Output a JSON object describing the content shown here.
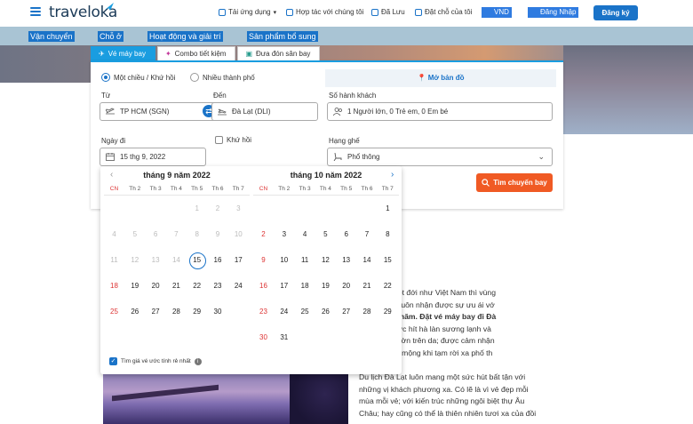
{
  "brand": {
    "logo": "traveloka"
  },
  "nav": {
    "app": "Tải ứng dụng",
    "partner": "Hợp tác với chúng tôi",
    "saved": "Đã Lưu",
    "bookings": "Đặt chỗ của tôi",
    "currency": "VND",
    "login": "Đăng Nhập",
    "register": "Đăng ký"
  },
  "categories": [
    "Vận chuyển",
    "Chỗ ở",
    "Hoạt động và giải trí",
    "Sản phẩm bổ sung"
  ],
  "product_tabs": [
    {
      "label": "Vé máy bay",
      "active": true
    },
    {
      "label": "Combo tiết kiệm",
      "active": false
    },
    {
      "label": "Đưa đón sân bay",
      "active": false
    }
  ],
  "search": {
    "trip_oneway": "Một chiều / Khứ hồi",
    "trip_multi": "Nhiều thành phố",
    "map_button": "Mở bản đồ",
    "from_label": "Từ",
    "from_value": "TP HCM (SGN)",
    "to_label": "Đến",
    "to_value": "Đà Lạt (DLI)",
    "pax_label": "Số hành khách",
    "pax_value": "1 Người lớn, 0 Trẻ em, 0 Em bé",
    "depart_label": "Ngày đi",
    "depart_value": "15 thg 9, 2022",
    "return_label": "Khứ hồi",
    "class_label": "Hạng ghế",
    "class_value": "Phổ thông",
    "search_button": "Tìm chuyến bay"
  },
  "calendar": {
    "weekdays": [
      "CN",
      "Th 2",
      "Th 3",
      "Th 4",
      "Th 5",
      "Th 6",
      "Th 7"
    ],
    "months": [
      {
        "title": "tháng 9 năm 2022",
        "weeks": [
          [
            "",
            "",
            "",
            "",
            "1",
            "2",
            "3"
          ],
          [
            "4",
            "5",
            "6",
            "7",
            "8",
            "9",
            "10"
          ],
          [
            "11",
            "12",
            "13",
            "14",
            "15",
            "16",
            "17"
          ],
          [
            "18",
            "19",
            "20",
            "21",
            "22",
            "23",
            "24"
          ],
          [
            "25",
            "26",
            "27",
            "28",
            "29",
            "30",
            ""
          ]
        ],
        "disabled_through": 14,
        "selected": "15"
      },
      {
        "title": "tháng 10 năm 2022",
        "weeks": [
          [
            "",
            "",
            "",
            "",
            "",
            "",
            "1"
          ],
          [
            "2",
            "3",
            "4",
            "5",
            "6",
            "7",
            "8"
          ],
          [
            "9",
            "10",
            "11",
            "12",
            "13",
            "14",
            "15"
          ],
          [
            "16",
            "17",
            "18",
            "19",
            "20",
            "21",
            "22"
          ],
          [
            "23",
            "24",
            "25",
            "26",
            "27",
            "28",
            "29"
          ],
          [
            "30",
            "31",
            "",
            "",
            "",
            "",
            ""
          ]
        ],
        "disabled_through": 0,
        "selected": ""
      }
    ],
    "footer": "Tìm giá vé ước tính rẻ nhất"
  },
  "article": {
    "lines": [
      "ất nước nhiệt đới như Việt Nam thì vùng",
      "như Đà Lạt luôn nhận được sự ưu ái vớ",
      "ạnh quanh năm. Đặt vé máy bay đi Đà",
      "sàng để được hít hà làn sương lạnh và",
      "ơn gió mát vờn trên da; được cảm nhận",
      "ình yên, thơ mộng khi tạm rời xa phố th"
    ],
    "lines2": [
      "Du lịch Đà Lạt luôn mang một sức hút bất tận với",
      "những vị khách phương xa. Có lẽ là vì vẻ đẹp mỗi",
      "mùa mỗi vẻ; với kiến trúc những ngôi biệt thự Âu",
      "Châu; hay cũng có thể là thiên nhiên tươi xa của đồi"
    ]
  }
}
